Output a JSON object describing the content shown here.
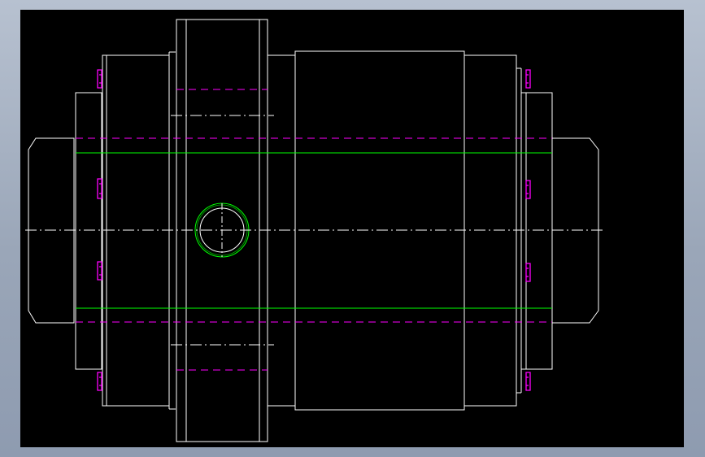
{
  "viewport": {
    "background_color": "#000000",
    "frame_color": "#9aa6b8"
  },
  "drawing": {
    "line_colors": {
      "outline": "#ffffff",
      "hidden": "#ff00ff",
      "bore": "#00ff00",
      "centerline": "#ffffff"
    },
    "layers": [
      "outline",
      "hidden-lines",
      "center-lines",
      "bore-lines"
    ],
    "features": [
      "left-shaft-stub",
      "left-hub",
      "left-flange",
      "central-sleeve",
      "right-flange",
      "right-hub",
      "right-shaft-stub",
      "side-port",
      "bolts"
    ]
  }
}
